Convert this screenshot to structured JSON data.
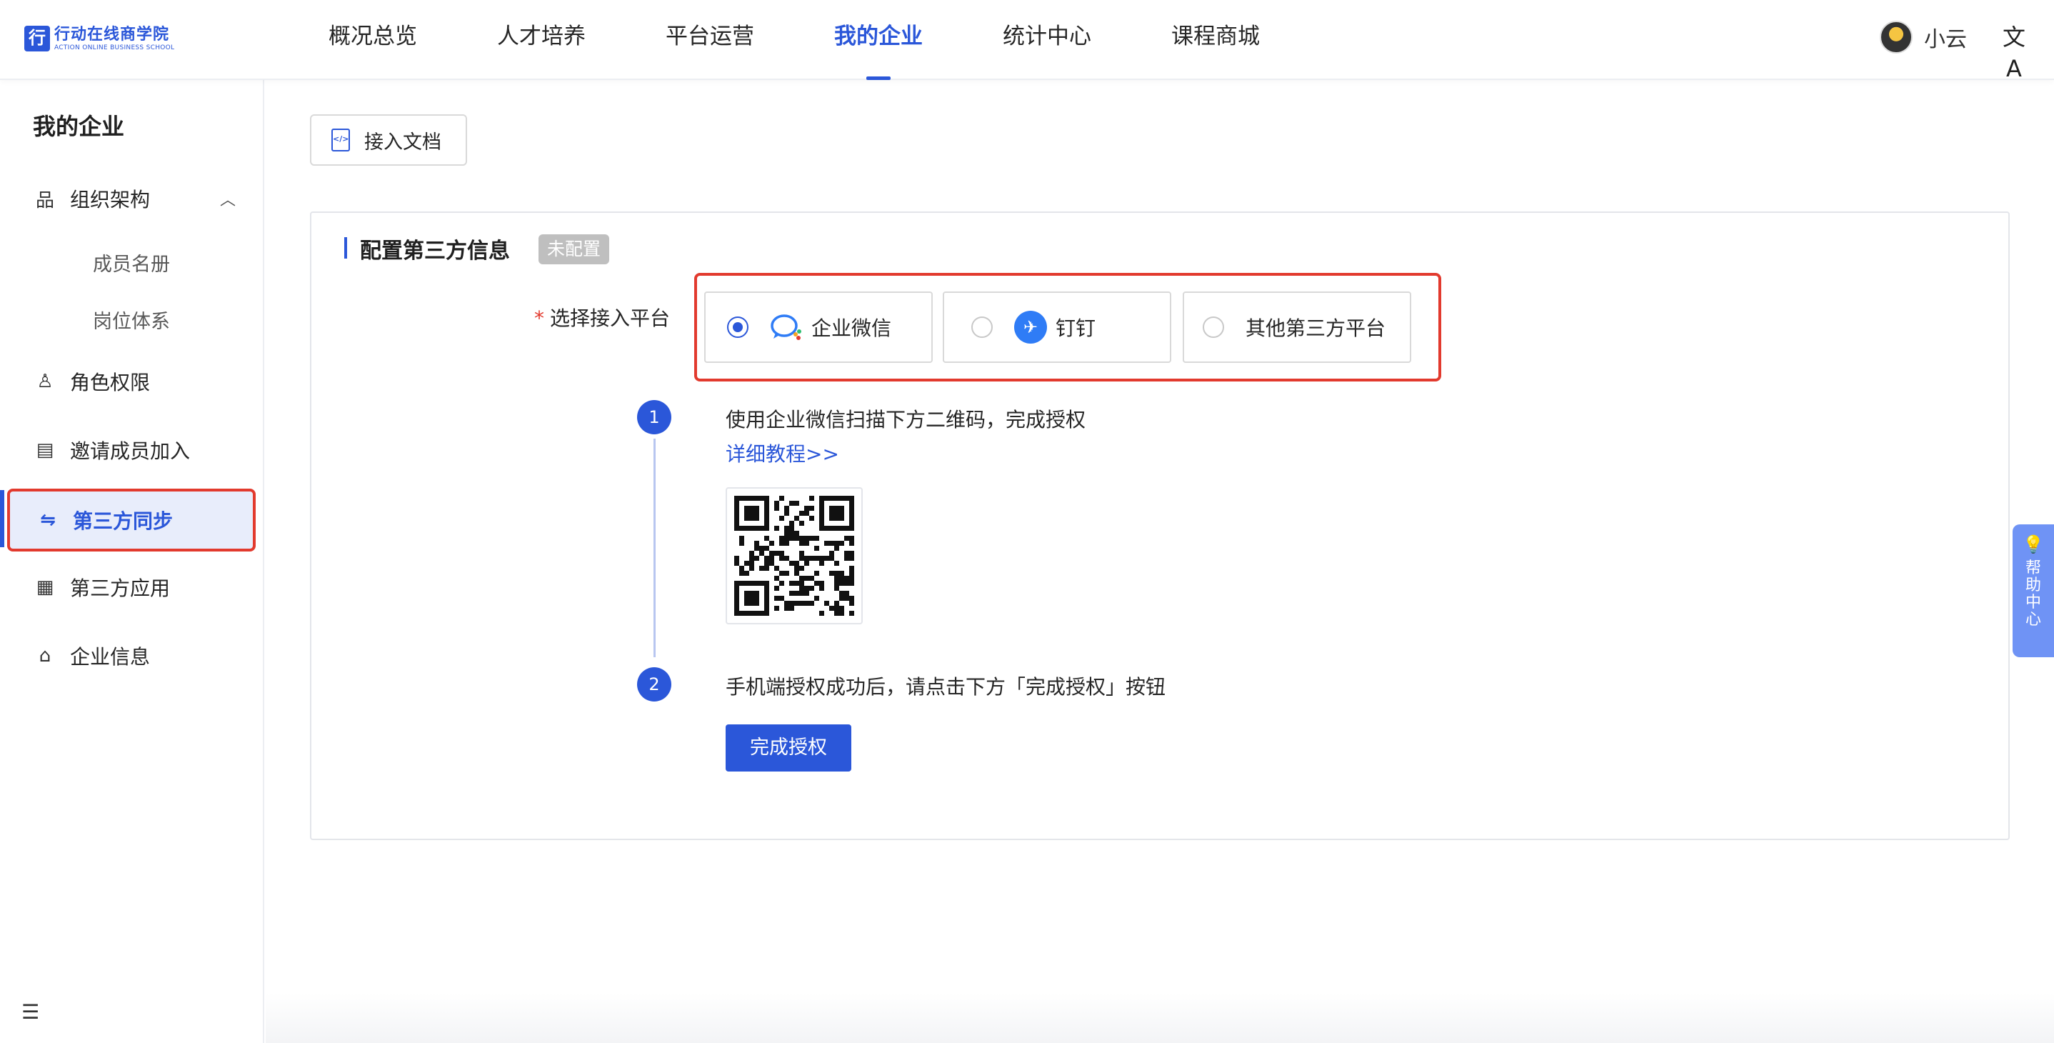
{
  "brand": {
    "cn": "行动在线商学院",
    "en": "ACTION ONLINE BUSINESS SCHOOL",
    "mark": "行",
    "accent": "#2b57d9"
  },
  "nav": {
    "items": [
      {
        "label": "概况总览"
      },
      {
        "label": "人才培养"
      },
      {
        "label": "平台运营"
      },
      {
        "label": "我的企业",
        "active": true
      },
      {
        "label": "统计中心"
      },
      {
        "label": "课程商城"
      }
    ]
  },
  "user": {
    "name": "小云",
    "translate_icon": "文A"
  },
  "sidebar": {
    "title": "我的企业",
    "items": [
      {
        "label": "组织架构",
        "icon": "org-tree-icon",
        "glyph": "品"
      },
      {
        "label": "成员名册",
        "sub": true
      },
      {
        "label": "岗位体系",
        "sub": true
      },
      {
        "label": "角色权限",
        "icon": "user-key-icon",
        "glyph": "♙"
      },
      {
        "label": "邀请成员加入",
        "icon": "invite-icon",
        "glyph": "▤"
      },
      {
        "label": "第三方同步",
        "icon": "sync-icon",
        "glyph": "⇋",
        "active": true
      },
      {
        "label": "第三方应用",
        "icon": "apps-icon",
        "glyph": "▦"
      },
      {
        "label": "企业信息",
        "icon": "home-icon",
        "glyph": "⌂"
      }
    ],
    "chevron": "︿",
    "collapse_glyph": "☰"
  },
  "toolbar": {
    "doc_button": "接入文档",
    "doc_icon_glyph": "</>"
  },
  "card": {
    "title": "配置第三方信息",
    "status_tag": "未配置",
    "platform_label": "选择接入平台",
    "required_mark": "*",
    "platforms": [
      {
        "label": "企业微信",
        "checked": true
      },
      {
        "label": "钉钉",
        "checked": false,
        "glyph": "✈"
      },
      {
        "label": "其他第三方平台",
        "checked": false
      }
    ],
    "steps": [
      {
        "number": "1",
        "text": "使用企业微信扫描下方二维码，完成授权",
        "link": "详细教程>>"
      },
      {
        "number": "2",
        "text": "手机端授权成功后，请点击下方「完成授权」按钮",
        "button": "完成授权"
      }
    ]
  },
  "help": {
    "label": "帮助中心",
    "icon_glyph": "💡",
    "color": "#6f93f5"
  },
  "colors": {
    "highlight": "#e23a2e",
    "active_bg": "#e8edfb"
  }
}
